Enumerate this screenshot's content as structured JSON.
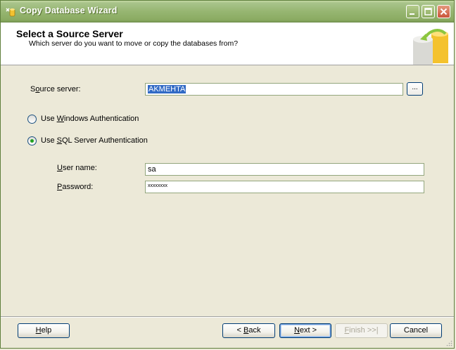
{
  "window": {
    "title": "Copy Database Wizard"
  },
  "header": {
    "title": "Select a Source Server",
    "subtitle": "Which server do you want to move or copy the databases from?"
  },
  "form": {
    "source_server_label_pre": "S",
    "source_server_label_u": "o",
    "source_server_label_post": "urce server:",
    "source_server_value": "AKMEHTA",
    "browse_label": "...",
    "windows_auth_pre": "Use ",
    "windows_auth_u": "W",
    "windows_auth_post": "indows Authentication",
    "sql_auth_pre": "Use ",
    "sql_auth_u": "S",
    "sql_auth_post": "QL Server Authentication",
    "selected_auth": "sql",
    "username_label_u": "U",
    "username_label_post": "ser name:",
    "username_value": "sa",
    "password_label_u": "P",
    "password_label_post": "assword:",
    "password_value": "xxxxxxxx"
  },
  "footer": {
    "help_u": "H",
    "help_post": "elp",
    "back_pre": "< ",
    "back_u": "B",
    "back_post": "ack",
    "next_u": "N",
    "next_post": "ext >",
    "finish_u": "F",
    "finish_post": "inish >>|",
    "cancel": "Cancel"
  },
  "colors": {
    "titlebar": "#97b672",
    "selection": "#316ac5",
    "radio_dot": "#21a121"
  }
}
